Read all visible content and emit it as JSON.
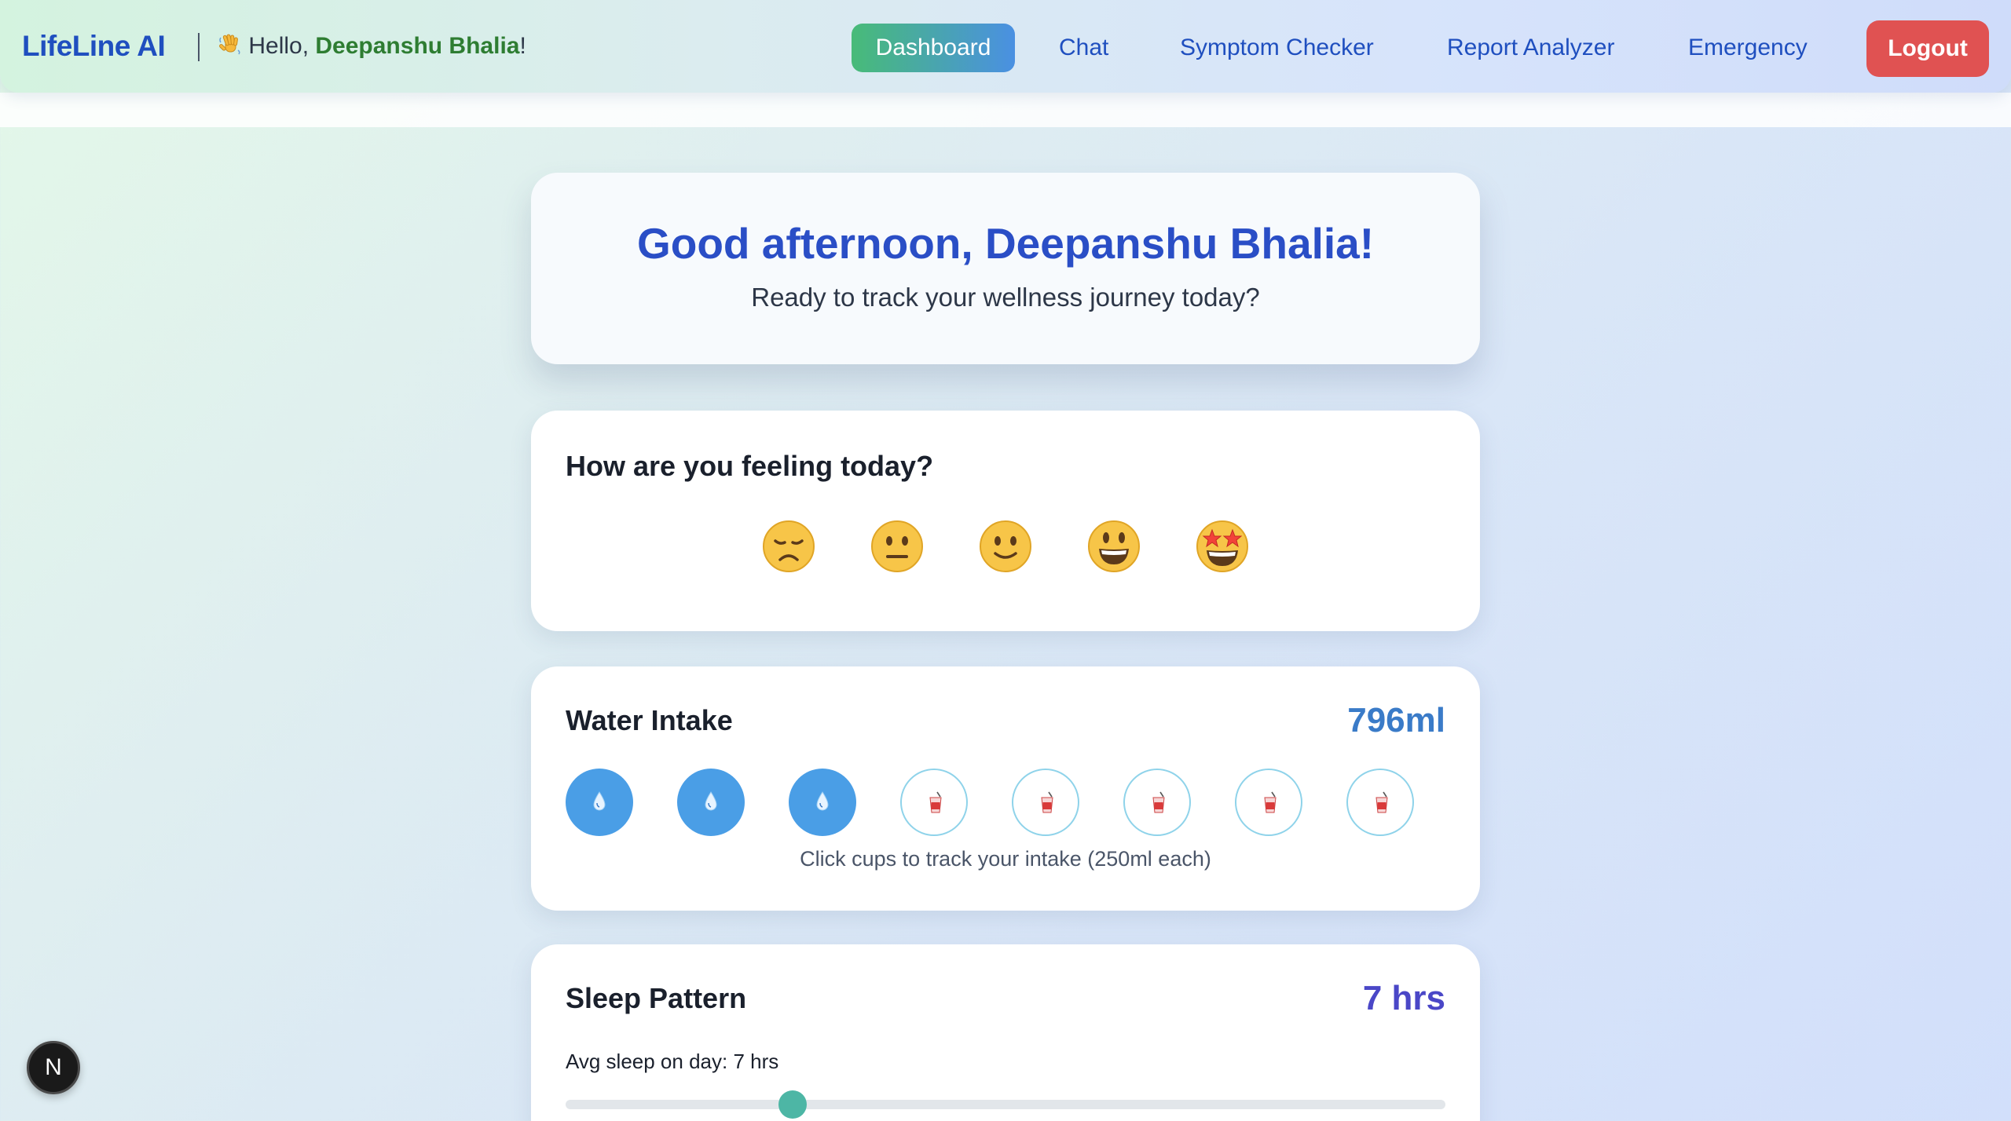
{
  "navbar": {
    "brand": "LifeLine AI",
    "greeting_prefix": "Hello, ",
    "greeting_name": "Deepanshu Bhalia",
    "greeting_suffix": "!",
    "wave_icon": "waving-hand-icon",
    "items": [
      {
        "label": "Dashboard",
        "active": true
      },
      {
        "label": "Chat"
      },
      {
        "label": "Symptom Checker"
      },
      {
        "label": "Report Analyzer"
      },
      {
        "label": "Emergency"
      }
    ],
    "logout_label": "Logout"
  },
  "welcome": {
    "title": "Good afternoon, Deepanshu Bhalia!",
    "subtitle": "Ready to track your wellness journey today?"
  },
  "mood": {
    "heading": "How are you feeling today?",
    "options": [
      "disappointed-face-icon",
      "neutral-face-icon",
      "slightly-smiling-face-icon",
      "grinning-face-icon",
      "star-struck-face-icon"
    ]
  },
  "water": {
    "heading": "Water Intake",
    "value": "796ml",
    "cups_filled": 3,
    "cups_total": 8,
    "filled_icon": "droplet-icon",
    "empty_icon": "cup-with-straw-icon",
    "hint": "Click cups to track your intake (250ml each)"
  },
  "sleep": {
    "heading": "Sleep Pattern",
    "value": "7 hrs",
    "subtitle": "Avg sleep on day: 7 hrs",
    "slider_fraction": 0.258
  },
  "colors": {
    "brand": "#1f4fbf",
    "greeting_name": "#2e7d32",
    "logout": "#e05252",
    "water_value": "#3a7bc8",
    "sleep_value": "#4a47c7",
    "cup_filled": "#4a9ee6",
    "slider_thumb": "#4db6a5"
  },
  "badge": {
    "label": "N"
  }
}
